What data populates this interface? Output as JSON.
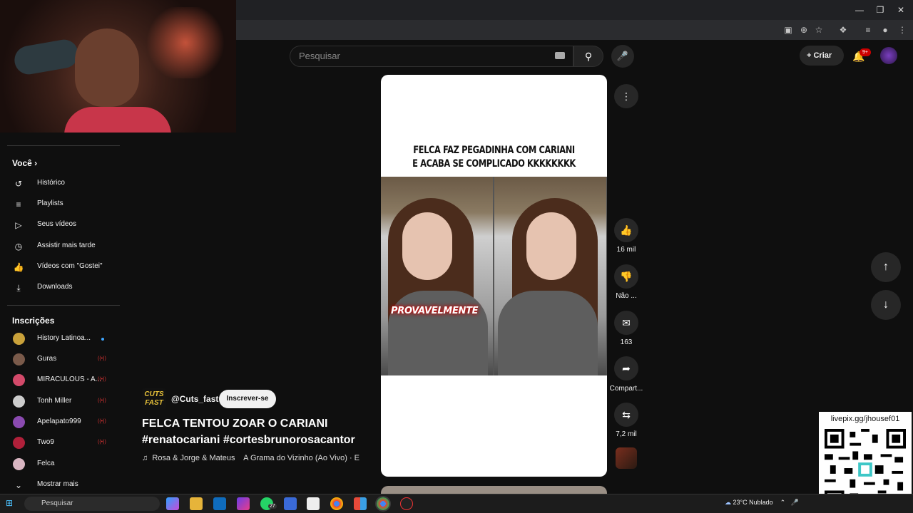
{
  "header": {
    "search_placeholder": "Pesquisar",
    "create_label": "Criar",
    "notif_badge": "9+"
  },
  "sidebar": {
    "you_label": "Você",
    "you_items": [
      {
        "label": "Histórico",
        "icon": "history-icon"
      },
      {
        "label": "Playlists",
        "icon": "playlists-icon"
      },
      {
        "label": "Seus vídeos",
        "icon": "your-videos-icon"
      },
      {
        "label": "Assistir mais tarde",
        "icon": "watch-later-icon"
      },
      {
        "label": "Vídeos com \"Gostei\"",
        "icon": "liked-icon"
      },
      {
        "label": "Downloads",
        "icon": "download-icon"
      }
    ],
    "subs_label": "Inscrições",
    "subs": [
      {
        "label": "History Latinoa...",
        "color": "#c9a13a",
        "status": "new"
      },
      {
        "label": "Guras",
        "color": "#7a5a4a",
        "status": "live"
      },
      {
        "label": "MIRACULOUS - A...",
        "color": "#d34a6a",
        "status": "live"
      },
      {
        "label": "Tonh Miller",
        "color": "#cccccc",
        "status": "live"
      },
      {
        "label": "Apelapato999",
        "color": "#8a4ab0",
        "status": "live"
      },
      {
        "label": "Two9",
        "color": "#b0203a",
        "status": "live"
      },
      {
        "label": "Felca",
        "color": "#d9b6c2",
        "status": "none"
      }
    ],
    "show_more": "Mostrar mais"
  },
  "short": {
    "caption_line1": "FELCA FAZ PEGADINHA COM CARIANI",
    "caption_line2": "E ACABA SE COMPLICADO KKKKKKKK",
    "overlay_text": "PROVAVELMENTE",
    "likes": "16 mil",
    "dislike_label": "Não ...",
    "comments": "163",
    "share_label": "Compart...",
    "remix_count": "7,2 mil"
  },
  "meta": {
    "channel_badge": "CUTS FAST",
    "channel": "@Cuts_fast",
    "subscribe": "Inscrever-se",
    "title_line1": "FELCA TENTOU ZOAR O CARIANI",
    "title_line2": "#renatocariani #cortesbrunorosacantor",
    "music_artist": "Rosa & Jorge & Mateus",
    "music_track": "A Grama do Vizinho (Ao Vivo) · E"
  },
  "overlay": {
    "qr_url": "livepix.gg/jhousef01"
  },
  "taskbar": {
    "search_label": "Pesquisar",
    "weather": "23°C  Nublado",
    "whatsapp_badge": "27"
  },
  "colors": {
    "accent_red": "#cc0000",
    "bg": "#0f0f0f",
    "chip": "#272727"
  }
}
